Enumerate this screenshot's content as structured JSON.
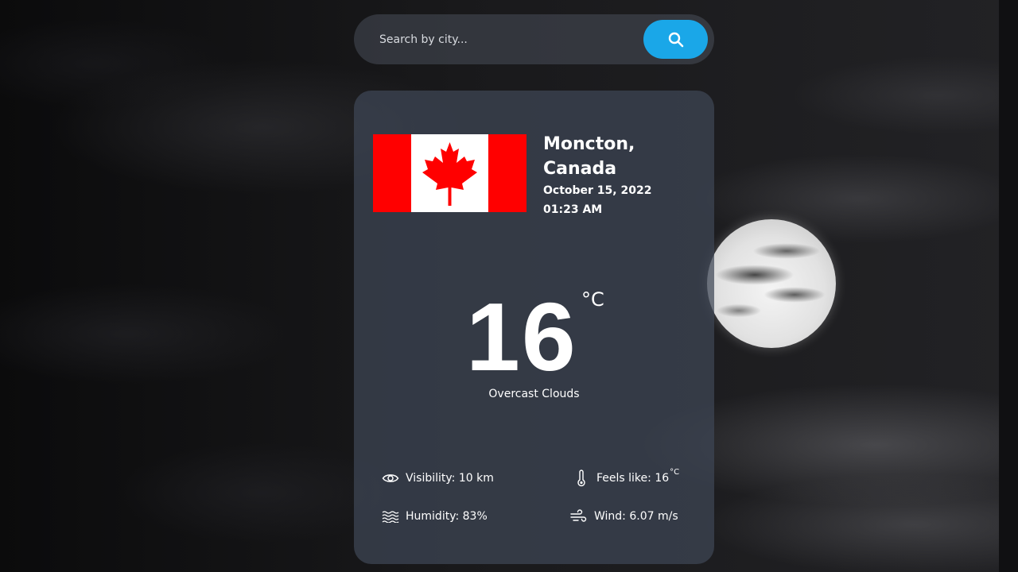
{
  "search": {
    "placeholder": "Search by city...",
    "value": "",
    "button_icon": "search-icon",
    "button_color": "#1aa7e8"
  },
  "location": {
    "city_line1": "Moncton,",
    "city_line2": "Canada",
    "date": "October 15, 2022",
    "time": "01:23 AM",
    "flag": "canada-flag"
  },
  "weather": {
    "temperature": "16",
    "unit": "°C",
    "condition": "Overcast Clouds"
  },
  "stats": {
    "visibility": {
      "icon": "eye-icon",
      "label": "Visibility: 10 km"
    },
    "humidity": {
      "icon": "waves-icon",
      "label": "Humidity: 83%"
    },
    "feels_like": {
      "icon": "thermometer-icon",
      "label": "Feels like: 16",
      "unit": "°C"
    },
    "wind": {
      "icon": "wind-icon",
      "label": "Wind: 6.07 m/s"
    }
  },
  "colors": {
    "accent": "#1aa7e8",
    "card": "#3e4656",
    "flag_red": "#ff0000"
  }
}
